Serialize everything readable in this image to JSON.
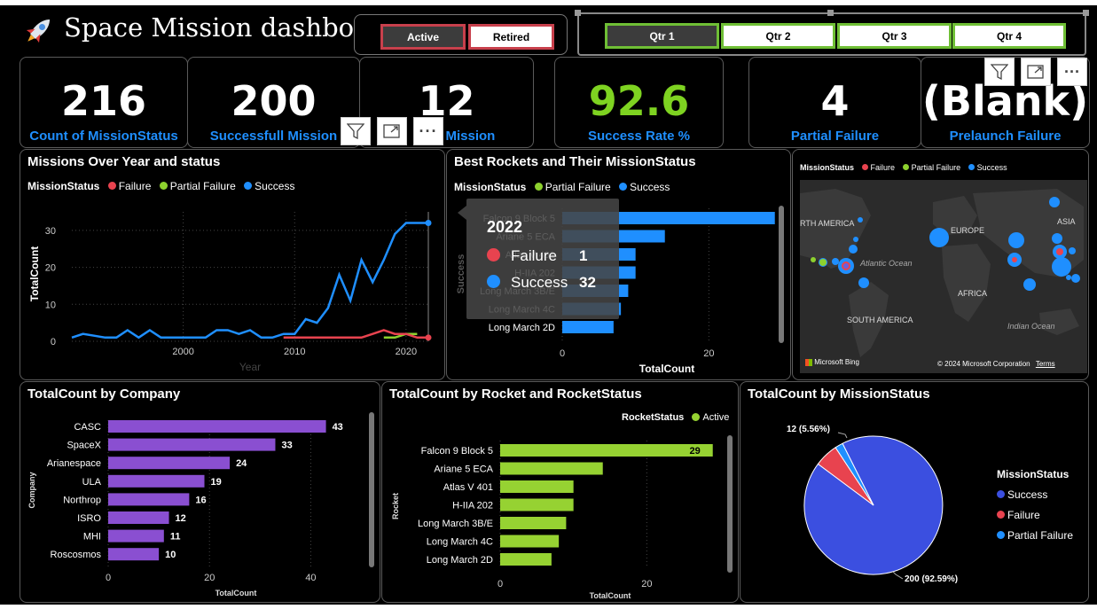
{
  "header": {
    "title": "Space Mission dashboard",
    "status_buttons": [
      {
        "label": "Active",
        "selected": true
      },
      {
        "label": "Retired",
        "selected": false
      }
    ],
    "quarter_buttons": [
      {
        "label": "Qtr 1",
        "selected": true
      },
      {
        "label": "Qtr 2",
        "selected": false
      },
      {
        "label": "Qtr 3",
        "selected": false
      },
      {
        "label": "Qtr 4",
        "selected": false
      }
    ]
  },
  "kpis": [
    {
      "value": "216",
      "label": "Count of MissionStatus",
      "color": "#ffffff"
    },
    {
      "value": "200",
      "label": "Successfull Mission",
      "color": "#ffffff"
    },
    {
      "value": "12",
      "label": "a Mission",
      "color": "#ffffff"
    },
    {
      "value": "92.6",
      "label": "Success Rate %",
      "color": "#7ed321"
    },
    {
      "value": "4",
      "label": "Partial Failure",
      "color": "#ffffff"
    },
    {
      "value": "(Blank)",
      "label": "Prelaunch Failure",
      "color": "#ffffff"
    }
  ],
  "visual_header_icons": [
    "filter-icon",
    "focus-mode-icon",
    "more-options-icon"
  ],
  "colors": {
    "success": "#1f8fff",
    "failure": "#e8434f",
    "partial_failure": "#8dd12e",
    "company_bar": "#8a4fd1",
    "rocket_bar": "#96d232",
    "pie_success": "#3b4fe0",
    "kpi_accent": "#7ed321"
  },
  "missions_over_year": {
    "title": "Missions Over Year and status",
    "legend_title": "MissionStatus",
    "legend": [
      "Failure",
      "Partial Failure",
      "Success"
    ],
    "xlabel": "Year",
    "ylabel": "TotalCount"
  },
  "best_rockets": {
    "title": "Best Rockets and Their MissionStatus",
    "legend_title": "MissionStatus",
    "legend": [
      "Partial Failure",
      "Success"
    ],
    "xlabel": "TotalCount",
    "visible_label": "Long March 2D"
  },
  "tooltip": {
    "header": "2022",
    "rows": [
      {
        "label": "Failure",
        "value": "1"
      },
      {
        "label": "Success",
        "value": "32"
      }
    ]
  },
  "map": {
    "legend_title": "MissionStatus",
    "legend": [
      "Failure",
      "Partial Failure",
      "Success"
    ],
    "places": [
      "RTH AMERICA",
      "EUROPE",
      "ASIA",
      "Atlantic Ocean",
      "AFRICA",
      "SOUTH AMERICA",
      "Indian Ocean"
    ],
    "brand": "Microsoft Bing",
    "copyright": "© 2024 Microsoft Corporation",
    "terms": "Terms"
  },
  "company_chart": {
    "title": "TotalCount by Company",
    "xlabel": "TotalCount",
    "ylabel": "Company"
  },
  "rocket_chart": {
    "title": "TotalCount by Rocket and RocketStatus",
    "legend_title": "RocketStatus",
    "legend": [
      "Active"
    ],
    "xlabel": "TotalCount",
    "ylabel": "Rocket"
  },
  "pie_chart": {
    "title": "TotalCount by MissionStatus",
    "legend_title": "MissionStatus",
    "legend": [
      "Success",
      "Failure",
      "Partial Failure"
    ],
    "label_top": "12 (5.56%)",
    "label_bottom": "200 (92.59%)"
  },
  "chart_data": [
    {
      "type": "line",
      "title": "Missions Over Year and status",
      "xlabel": "Year",
      "ylabel": "TotalCount",
      "xlim": [
        1990,
        2022
      ],
      "ylim": [
        0,
        35
      ],
      "x_ticks": [
        2000,
        2010,
        2020
      ],
      "y_ticks": [
        0,
        10,
        20,
        30
      ],
      "series": [
        {
          "name": "Success",
          "x": [
            1990,
            1991,
            1992,
            1993,
            1994,
            1995,
            1996,
            1997,
            1998,
            1999,
            2000,
            2001,
            2002,
            2003,
            2004,
            2005,
            2006,
            2007,
            2008,
            2009,
            2010,
            2011,
            2012,
            2013,
            2014,
            2015,
            2016,
            2017,
            2018,
            2019,
            2020,
            2021,
            2022
          ],
          "y": [
            1,
            2,
            1.5,
            1,
            1,
            3,
            1,
            3,
            1,
            1,
            1,
            1,
            1,
            3,
            3,
            2,
            3,
            1,
            1,
            2,
            2,
            6,
            5,
            9,
            18,
            11,
            22,
            16,
            22,
            29,
            32,
            32,
            32
          ]
        },
        {
          "name": "Failure",
          "x": [
            2009,
            2010,
            2011,
            2012,
            2013,
            2014,
            2015,
            2016,
            2017,
            2018,
            2019,
            2020,
            2021,
            2022
          ],
          "y": [
            1,
            1,
            1,
            1,
            1,
            1,
            1,
            1,
            2,
            3,
            2,
            2,
            1,
            1
          ]
        },
        {
          "name": "Partial Failure",
          "x": [
            2018,
            2019,
            2020,
            2021
          ],
          "y": [
            1,
            1,
            2,
            2
          ]
        }
      ]
    },
    {
      "type": "bar",
      "title": "Best Rockets and Their MissionStatus",
      "categories": [
        "Falcon 9 Block 5",
        "Ariane 5 ECA",
        "Atlas V 401",
        "H-IIA 202",
        "Long March 3B/E",
        "Long March 4C",
        "Long March 2D"
      ],
      "series": [
        {
          "name": "Success",
          "values": [
            29,
            14,
            10,
            10,
            9,
            8,
            7
          ]
        }
      ],
      "xlabel": "TotalCount",
      "x_ticks": [
        0,
        20
      ],
      "xlim": [
        0,
        30
      ]
    },
    {
      "type": "bar",
      "title": "TotalCount by Company",
      "categories": [
        "CASC",
        "SpaceX",
        "Arianespace",
        "ULA",
        "Northrop",
        "ISRO",
        "MHI",
        "Roscosmos"
      ],
      "values": [
        43,
        33,
        24,
        19,
        16,
        12,
        11,
        10
      ],
      "xlabel": "TotalCount",
      "ylabel": "Company",
      "x_ticks": [
        0,
        20,
        40
      ],
      "xlim": [
        0,
        45
      ]
    },
    {
      "type": "bar",
      "title": "TotalCount by Rocket and RocketStatus",
      "categories": [
        "Falcon 9 Block 5",
        "Ariane 5 ECA",
        "Atlas V 401",
        "H-IIA 202",
        "Long March 3B/E",
        "Long March 4C",
        "Long March 2D"
      ],
      "series": [
        {
          "name": "Active",
          "values": [
            29,
            14,
            10,
            10,
            9,
            8,
            7
          ]
        }
      ],
      "data_labels": [
        "29"
      ],
      "xlabel": "TotalCount",
      "ylabel": "Rocket",
      "x_ticks": [
        0,
        20
      ],
      "xlim": [
        0,
        30
      ]
    },
    {
      "type": "pie",
      "title": "TotalCount by MissionStatus",
      "categories": [
        "Success",
        "Failure",
        "Partial Failure"
      ],
      "values": [
        200,
        12,
        4
      ],
      "data_labels": [
        "200 (92.59%)",
        "12 (5.56%)"
      ]
    }
  ]
}
